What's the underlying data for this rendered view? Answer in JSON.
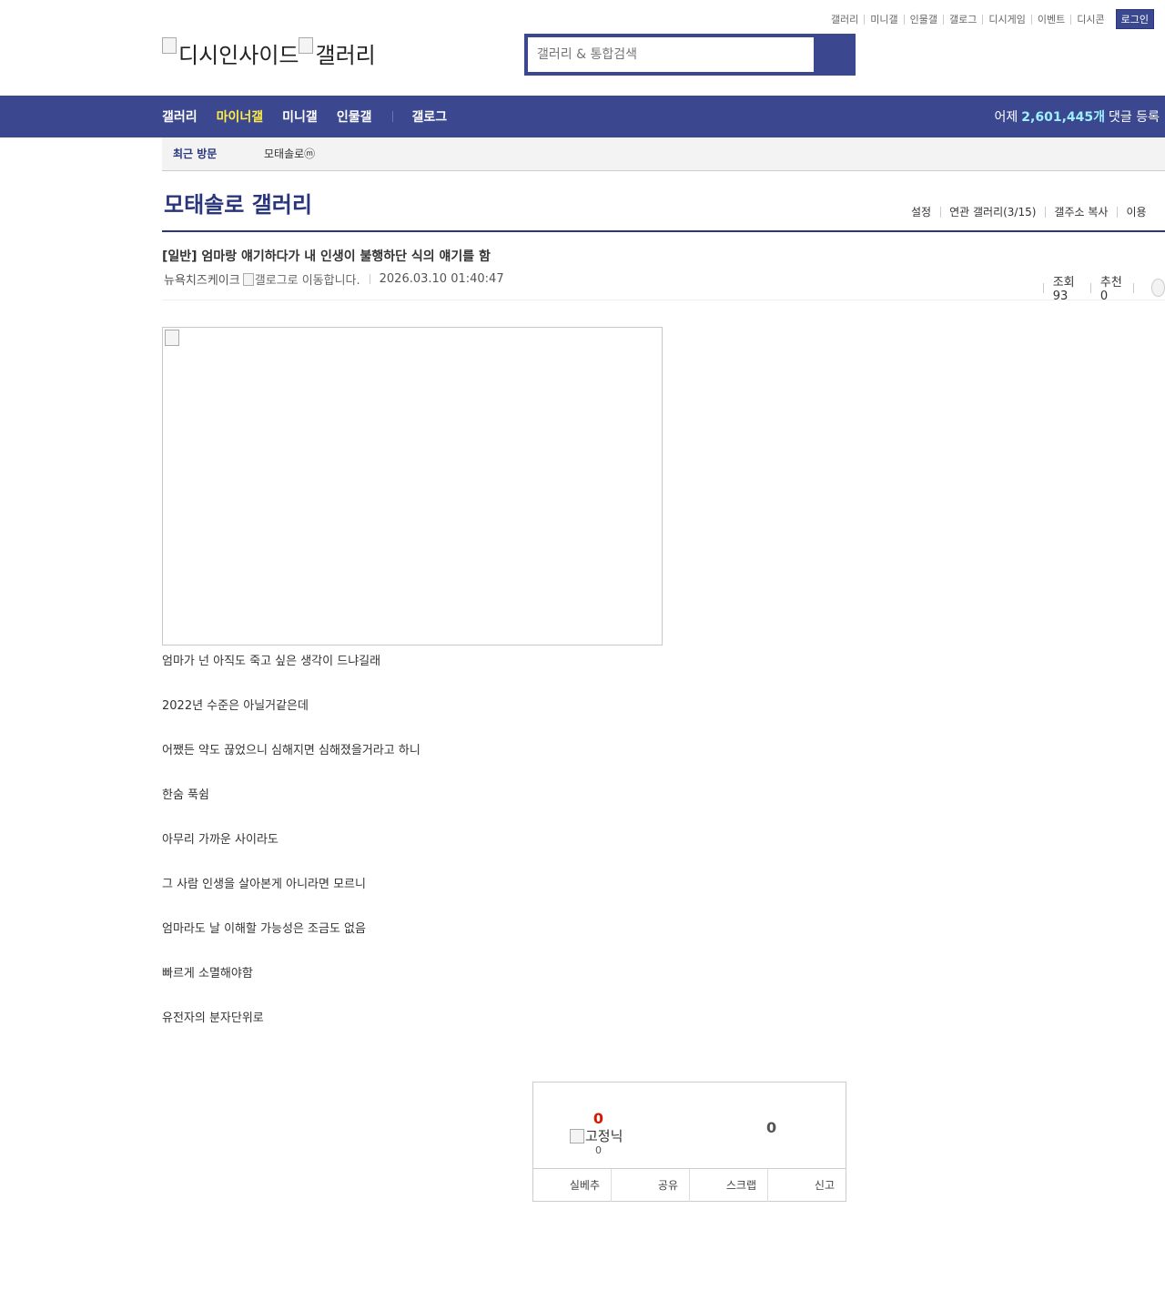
{
  "util_links": [
    "갤러리",
    "미니갤",
    "인물갤",
    "갤로그",
    "디시게임",
    "이벤트",
    "디시콘"
  ],
  "login_label": "로그인",
  "logo": {
    "brand": "디시인사이드",
    "section": "갤러리"
  },
  "search": {
    "placeholder": "갤러리 & 통합검색"
  },
  "nav": {
    "items": [
      {
        "label": "갤러리",
        "active": false
      },
      {
        "label": "마이너갤",
        "active": true
      },
      {
        "label": "미니갤",
        "active": false
      },
      {
        "label": "인물갤",
        "active": false
      }
    ],
    "gallog": "갤로그",
    "stat_prefix": "어제",
    "stat_number": "2,601,445개",
    "stat_suffix": "댓글 등록"
  },
  "recent": {
    "title": "최근 방문",
    "gallery": "모태솔로ⓜ"
  },
  "gallery": {
    "title": "모태솔로 갤러리",
    "menu": [
      "설정",
      "연관 갤러리(3/15)",
      "갤주소 복사",
      "이용"
    ]
  },
  "post": {
    "title": "[일반] 엄마랑 얘기하다가 내 인생이 불행하단 식의 얘기를 함",
    "author": "뉴욕치즈케이크",
    "gallog_alt": "갤로그로 이동합니다.",
    "date": "2026.03.10 01:40:47",
    "views_label": "조회 93",
    "recommend_label": "추천 0",
    "body": [
      "엄마가 넌 아직도 죽고 싶은 생각이 드냐길래",
      "2022년 수준은 아닐거같은데",
      "어쨌든 약도 끊었으니 심해지면 심해졌을거라고 하니",
      "한숨 푹쉼",
      "아무리 가까운 사이라도",
      "그 사람 인생을 살아본게 아니라면 모르니",
      "엄마라도 날 이해할 가능성은 조금도 없음",
      "빠르게 소멸해야함",
      "유전자의 분자단위로"
    ]
  },
  "recommend_box": {
    "up_count": "0",
    "fixed_alt": "고정닉",
    "fixed_count": "0",
    "down_count": "0",
    "actions": [
      "실베추",
      "공유",
      "스크랩",
      "신고"
    ]
  },
  "colors": {
    "brand": "#3b4890",
    "brand_dark": "#29367c",
    "active_nav": "#ffed45",
    "stat_number": "#9ef0ff",
    "up_count": "#d31900"
  }
}
